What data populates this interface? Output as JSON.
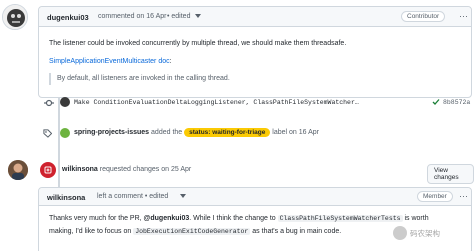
{
  "comment1": {
    "author": "dugenkui03",
    "meta": "commented on 16 Apr",
    "edited": "• edited",
    "role": "Contributor",
    "body": "The listener could be invoked concurrently by multiple thread, we should make them threadsafe.",
    "link_text": "SimpleApplicationEventMulticaster doc",
    "link_suffix": ":",
    "quote": "By default, all listeners are invoked in the calling thread."
  },
  "commit": {
    "message": "Make ConditionEvaluationDeltaLoggingListener, ClassPathFileSystemWatcher…",
    "sha": "8b8572a"
  },
  "label_event": {
    "actor": "spring-projects-issues",
    "action": "added the",
    "label": "status: waiting-for-triage",
    "suffix": "label on 16 Apr"
  },
  "review_event": {
    "actor": "wilkinsona",
    "text": "requested changes on 25 Apr",
    "button": "View changes"
  },
  "comment2": {
    "author": "wilkinsona",
    "meta": "left a comment • edited",
    "role": "Member",
    "line1_a": "Thanks very much for the PR, ",
    "mention": "@dugenkui03",
    "line1_b": ". While I think the change to ",
    "code1": "ClassPathFileSystemWatcherTests",
    "line1_c": " is worth",
    "line2_a": "making, I'd like to focus on ",
    "code2": "JobExecutionExitCodeGenerator",
    "line2_b": " as that's a bug in main code."
  },
  "watermark": "码农架构",
  "colors": {
    "label": "#fbca04",
    "review_icon": "#cf222e",
    "link": "#0969da"
  }
}
